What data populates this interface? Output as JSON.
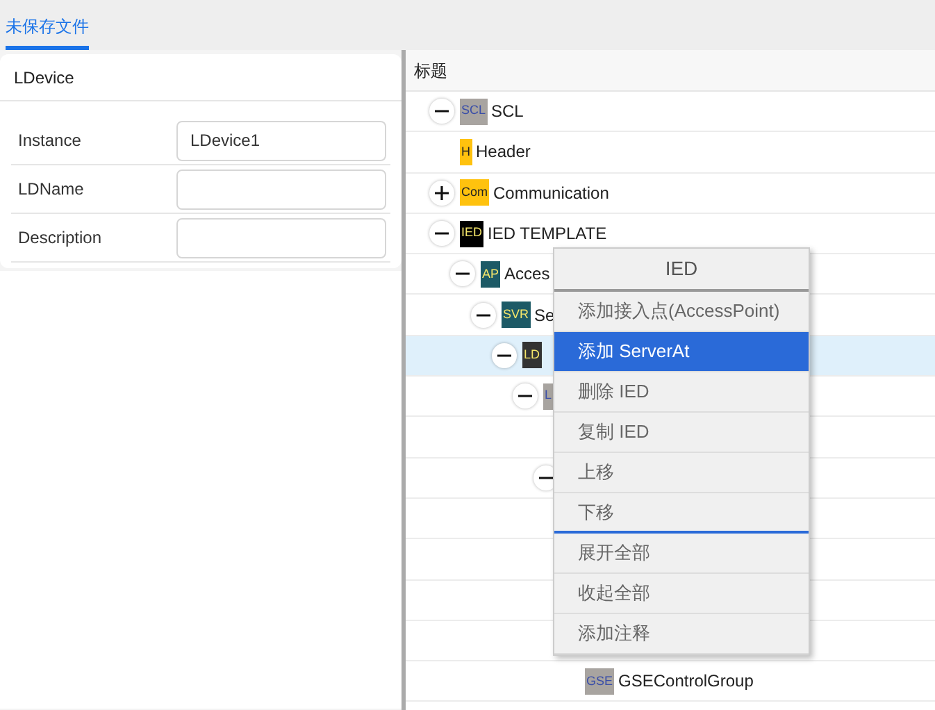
{
  "tabs": [
    {
      "label": "未保存文件",
      "selected": true
    }
  ],
  "form": {
    "title": "LDevice",
    "fields": [
      {
        "label": "Instance",
        "value": "LDevice1"
      },
      {
        "label": "LDName"
      },
      {
        "label": "Description"
      }
    ]
  },
  "tree": {
    "header": "标题",
    "nodes": [
      {
        "badge": "SCL",
        "color": "#a8a4a0",
        "label": "SCL",
        "expanded": true,
        "selected": false,
        "children": [
          {
            "badge": "H",
            "color": "#ffc20e",
            "label": "Header",
            "selected": false
          },
          {
            "badge": "Com",
            "color": "#ffc20e",
            "label": "Communication",
            "expanded": false,
            "selected": false
          },
          {
            "badge": "IED",
            "color": "#000000",
            "label": "IED TEMPLATE",
            "expanded": true,
            "selected": false,
            "children": [
              {
                "badge": "AP",
                "color": "#1d5a66",
                "label": "Acces",
                "expanded": true,
                "selected": false,
                "children": [
                  {
                    "badge": "SVR",
                    "color": "#1d5a66",
                    "label": "Se",
                    "expanded": true,
                    "selected": false,
                    "children": [
                      {
                        "badge": "LD",
                        "color": "#333333",
                        "expanded": true,
                        "selected": true,
                        "children": [
                          {
                            "badge": "L",
                            "color": "#a8a4a0",
                            "expanded": true,
                            "selected": false,
                            "children": [
                              {
                                "selected": false
                              },
                              {
                                "expanded": true,
                                "selected": false,
                                "children": [
                                  {
                                    "selected": false
                                  },
                                  {
                                    "selected": false
                                  },
                                  {
                                    "selected": false
                                  },
                                  {
                                    "selected": false
                                  },
                                  {
                                    "badge": "GSE",
                                    "color": "#a8a4a0",
                                    "label": "GSEControlGroup",
                                    "selected": false
                                  }
                                ]
                              }
                            ]
                          }
                        ]
                      }
                    ]
                  }
                ]
              }
            ]
          }
        ]
      }
    ]
  },
  "context_menu": {
    "title": "IED",
    "items": [
      {
        "label": "添加接入点(AccessPoint)",
        "selected": false
      },
      {
        "label": "添加 ServerAt",
        "selected": true
      },
      {
        "label": "删除 IED",
        "selected": false
      },
      {
        "label": "复制 IED",
        "selected": false
      },
      {
        "label": "上移",
        "selected": false
      },
      {
        "label": "下移",
        "selected": false,
        "separator_after": true
      },
      {
        "label": "展开全部",
        "selected": false
      },
      {
        "label": "收起全部",
        "selected": false
      },
      {
        "label": "添加注释",
        "selected": false
      }
    ]
  }
}
